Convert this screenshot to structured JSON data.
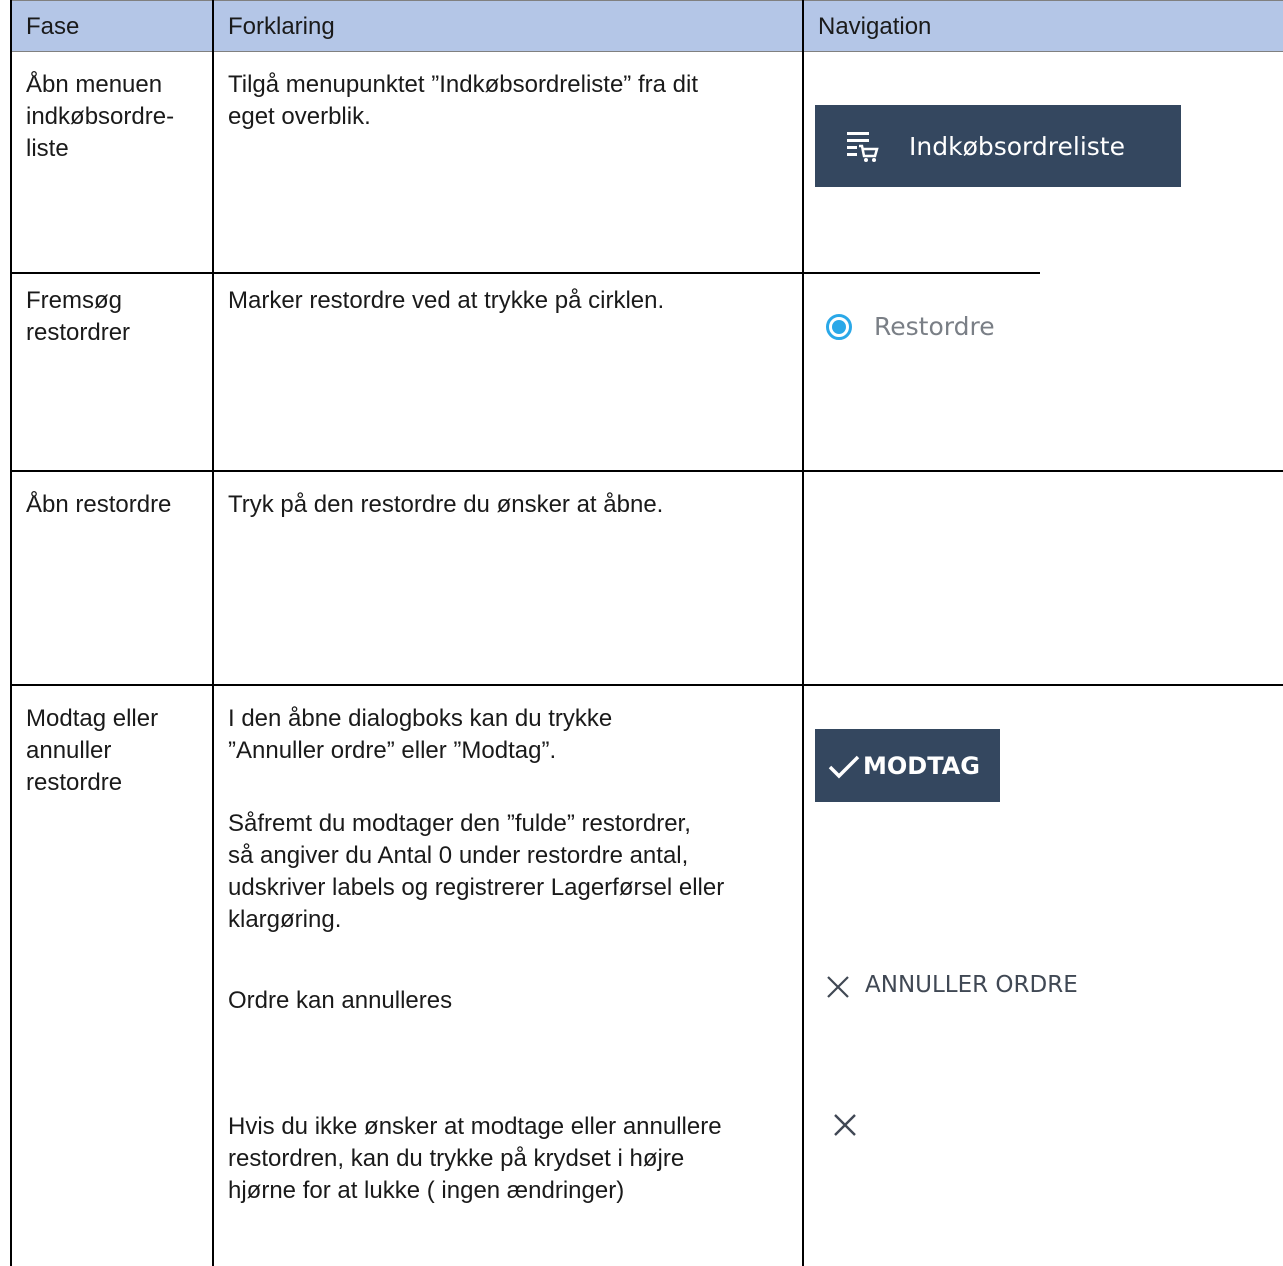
{
  "table": {
    "headers": [
      "Fase",
      "Forklaring",
      "Navigation"
    ],
    "rows": [
      {
        "fase": "Åbn menuen\nindkøbsordre-\nliste",
        "forklaring": "Tilgå menupunktet ”Indkøbsordreliste” fra dit\neget overblik.",
        "nav": {
          "button_label": "Indkøbsordreliste",
          "icon": "list-cart-icon"
        }
      },
      {
        "fase": "Fremsøg\nrestordrer",
        "forklaring": "Marker restordre ved at trykke på cirklen.",
        "nav": {
          "radio_label": "Restordre",
          "icon": "radio-selected-icon"
        }
      },
      {
        "fase": "Åbn restordre",
        "forklaring": "Tryk på den restordre du ønsker at åbne.",
        "nav": {}
      },
      {
        "fase": "Modtag eller\nannuller\nrestordre",
        "forklaring_p1": "I den åbne dialogboks kan du trykke\n ”Annuller ordre” eller ”Modtag”.",
        "forklaring_p2": "Såfremt du modtager den ”fulde” restordrer,\nså angiver du Antal 0 under restordre antal,\nudskriver labels og registrerer Lagerførsel eller\nklargøring.",
        "forklaring_p3": "Ordre kan annulleres",
        "forklaring_p4": "Hvis du ikke ønsker at modtage eller annullere\nrestordren, kan du trykke på krydset i højre\nhjørne for at lukke ( ingen ændringer)",
        "nav": {
          "modtag_label": "MODTAG",
          "annuller_label": "ANNULLER ORDRE",
          "modtag_icon": "check-icon",
          "annuller_icon": "close-icon",
          "close_icon": "close-icon"
        }
      }
    ]
  },
  "colors": {
    "header_bg": "#b4c6e7",
    "button_bg": "#34475f",
    "radio_accent": "#2aa8e8"
  }
}
